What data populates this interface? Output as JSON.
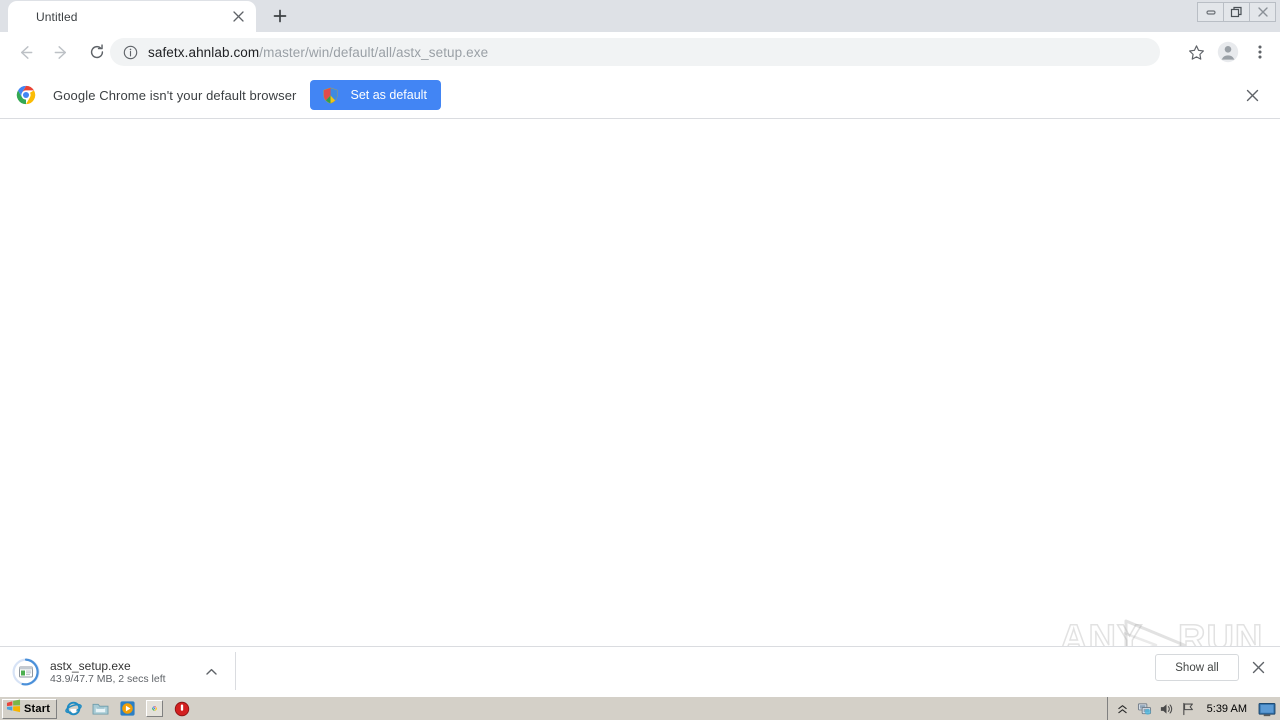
{
  "window": {
    "controls": [
      {
        "name": "minimize",
        "glyph": "minimize-icon"
      },
      {
        "name": "restore",
        "glyph": "restore-icon"
      },
      {
        "name": "close",
        "glyph": "close-icon"
      }
    ]
  },
  "tabstrip": {
    "tabs": [
      {
        "title": "Untitled",
        "close_label": "×"
      }
    ],
    "new_tab_label": "+"
  },
  "toolbar": {
    "back_icon": "back-arrow-icon",
    "forward_icon": "forward-arrow-icon",
    "reload_icon": "reload-icon",
    "omnibox": {
      "security_icon": "info-circle-icon",
      "host": "safetx.ahnlab.com",
      "path": "/master/win/default/all/astx_setup.exe",
      "full_url": "safetx.ahnlab.com/master/win/default/all/astx_setup.exe"
    },
    "bookmark_icon": "star-icon",
    "profile_icon": "avatar-icon",
    "menu_icon": "three-dot-menu-icon"
  },
  "infobar": {
    "logo_icon": "chrome-logo-icon",
    "message": "Google Chrome isn't your default browser",
    "button_label": "Set as default",
    "button_icon": "shield-icon",
    "button_color": "#4285f4",
    "close_label": "×"
  },
  "watermark": {
    "left_text": "ANY",
    "right_text": "RUN",
    "logo_icon": "play-triangle-icon"
  },
  "download_shelf": {
    "item": {
      "filename": "astx_setup.exe",
      "status": "43.9/47.7 MB, 2 secs left",
      "progress_percent": 92,
      "file_icon": "exe-file-icon",
      "menu_icon": "chevron-up-icon"
    },
    "show_all_label": "Show all",
    "close_label": "×"
  },
  "taskbar": {
    "start_label": "Start",
    "start_icon": "windows-flag-icon",
    "quick_launch": [
      {
        "name": "internet-explorer",
        "icon": "ie-icon"
      },
      {
        "name": "file-explorer",
        "icon": "folder-icon"
      },
      {
        "name": "media-player",
        "icon": "media-player-icon"
      },
      {
        "name": "google-chrome",
        "icon": "chrome-icon",
        "active": true
      },
      {
        "name": "stop-app",
        "icon": "red-circle-icon"
      }
    ],
    "tray": {
      "expand_icon": "chevron-up-icon",
      "network_icon": "network-icon",
      "volume_icon": "volume-icon",
      "flag_icon": "flag-icon",
      "clock": "5:39 AM",
      "show_desktop_icon": "show-desktop-icon"
    }
  }
}
